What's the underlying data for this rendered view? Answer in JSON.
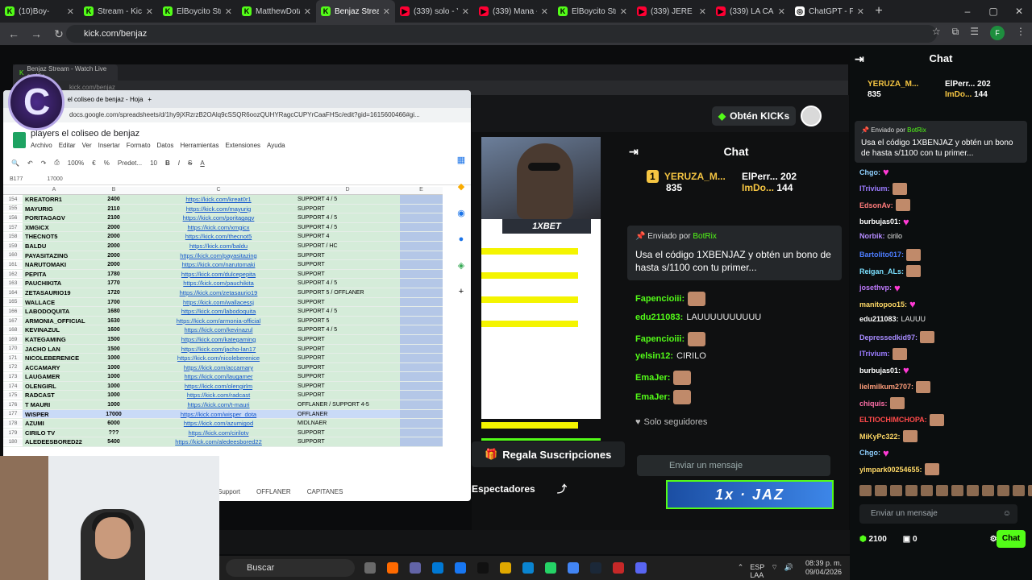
{
  "browser": {
    "tabs": [
      {
        "label": "(10)Boy-",
        "color": "#53fc18"
      },
      {
        "label": "Stream - Kick",
        "color": "#53fc18"
      },
      {
        "label": "ElBoycito Strea",
        "color": "#53fc18"
      },
      {
        "label": "MatthewDota",
        "color": "#53fc18"
      },
      {
        "label": "Benjaz Strea",
        "color": "#53fc18",
        "active": true
      },
      {
        "label": "(339) solo - Yo",
        "color": "#ff0033"
      },
      {
        "label": "(339) Mana - L",
        "color": "#ff0033"
      },
      {
        "label": "ElBoycito Strea",
        "color": "#53fc18"
      },
      {
        "label": "(339) JERE KLEI",
        "color": "#ff0033"
      },
      {
        "label": "(339) LA CANC",
        "color": "#ff0033"
      },
      {
        "label": "ChatGPT - Fran",
        "color": "#ffffff"
      }
    ],
    "url": "kick.com/benjaz",
    "profile_initial": "F"
  },
  "inner_browser": {
    "tab": "Benjaz Stream - Watch Live on Kic",
    "url": "kick.com/benjaz"
  },
  "sheet": {
    "tab": "el coliseo de benjaz - Hoja",
    "url": "docs.google.com/spreadsheets/d/1hy9jXRzrzB2OAlq9cSSQR6oozQUHYRagcCUPYrCaaFHSc/edit?gid=1615600466#gi...",
    "title": "players el coliseo de benjaz",
    "menu": [
      "Archivo",
      "Editar",
      "Ver",
      "Insertar",
      "Formato",
      "Datos",
      "Herramientas",
      "Extensiones",
      "Ayuda"
    ],
    "zoom": "100%",
    "font": "Predet...",
    "font_size": "10",
    "cell_ref": "B177",
    "formula": "17000",
    "columns": [
      "A",
      "B",
      "C",
      "D",
      "E"
    ],
    "rows": [
      {
        "n": "154",
        "name": "KREATORR1",
        "val": "2400",
        "link": "https://kick.com/kreat0r1",
        "role": "SUPPORT 4 / 5"
      },
      {
        "n": "155",
        "name": "MAYURIG",
        "val": "2110",
        "link": "https://kick.com/mayurig",
        "role": "SUPPORT"
      },
      {
        "n": "156",
        "name": "PORITAGAGV",
        "val": "2100",
        "link": "https://kick.com/poritagagv",
        "role": "SUPPORT 4 / 5"
      },
      {
        "n": "157",
        "name": "XMGICX",
        "val": "2000",
        "link": "https://kick.com/xmgicx",
        "role": "SUPPORT 4 / 5"
      },
      {
        "n": "158",
        "name": "THECNOT5",
        "val": "2000",
        "link": "https://kick.com/thecnot5",
        "role": "SUPPORT 4"
      },
      {
        "n": "159",
        "name": "BALDU",
        "val": "2000",
        "link": "https://kick.com/baldu",
        "role": "SUPPORT / HC"
      },
      {
        "n": "160",
        "name": "PAYASITAZING",
        "val": "2000",
        "link": "https://kick.com/payasitazing",
        "role": "SUPPORT"
      },
      {
        "n": "161",
        "name": "NARUTOMAKI",
        "val": "2000",
        "link": "https://kick.com/narutomaki",
        "role": "SUPPORT"
      },
      {
        "n": "162",
        "name": "PEPITA",
        "val": "1780",
        "link": "https://kick.com/dulcepepita",
        "role": "SUPPORT"
      },
      {
        "n": "163",
        "name": "PAUCHIKITA",
        "val": "1770",
        "link": "https://kick.com/pauchikita",
        "role": "SUPPORT 4 / 5"
      },
      {
        "n": "164",
        "name": "ZETASAURIO19",
        "val": "1720",
        "link": "https://kick.com/zetasaurio19",
        "role": "SUPPORT 5 / OFFLANER"
      },
      {
        "n": "165",
        "name": "WALLACE",
        "val": "1700",
        "link": "https://kick.com/wallacessj",
        "role": "SUPPORT"
      },
      {
        "n": "166",
        "name": "LABODOQUITA",
        "val": "1680",
        "link": "https://kick.com/labodoquita",
        "role": "SUPPORT 4 / 5"
      },
      {
        "n": "167",
        "name": "ARMONIA_OFFICIAL",
        "val": "1630",
        "link": "https://kick.com/armonia-official",
        "role": "SUPPORT 5"
      },
      {
        "n": "168",
        "name": "KEVINAZUL",
        "val": "1600",
        "link": "https://kick.com/kevinazul",
        "role": "SUPPORT 4 / 5"
      },
      {
        "n": "169",
        "name": "KATEGAMING",
        "val": "1500",
        "link": "https://kick.com/kategaming",
        "role": "SUPPORT"
      },
      {
        "n": "170",
        "name": "JACHO LAN",
        "val": "1500",
        "link": "https://kick.com/jacho-lan17",
        "role": "SUPPORT"
      },
      {
        "n": "171",
        "name": "NICOLEBERENICE",
        "val": "1000",
        "link": "https://kick.com/nicoleberenice",
        "role": "SUPPORT"
      },
      {
        "n": "172",
        "name": "ACCAMARY",
        "val": "1000",
        "link": "https://kick.com/accamary",
        "role": "SUPPORT"
      },
      {
        "n": "173",
        "name": "LAUGAMER",
        "val": "1000",
        "link": "https://kick.com/laugamer",
        "role": "SUPPORT"
      },
      {
        "n": "174",
        "name": "OLENGIRL",
        "val": "1000",
        "link": "https://kick.com/olengirlm",
        "role": "SUPPORT"
      },
      {
        "n": "175",
        "name": "RADCAST",
        "val": "1000",
        "link": "https://kick.com/radcast",
        "role": "SUPPORT"
      },
      {
        "n": "176",
        "name": "T MAURI",
        "val": "1000",
        "link": "https://kick.com/t-mauri",
        "role": "OFFLANER / SUPPORT 4-5"
      },
      {
        "n": "177",
        "name": "WISPER",
        "val": "17000",
        "link": "https://kick.com/wisper_dota",
        "role": "OFFLANER",
        "selected": true
      },
      {
        "n": "178",
        "name": "AZUMI",
        "val": "6000",
        "link": "https://kick.com/azumigod",
        "role": "MIDLNAER"
      },
      {
        "n": "179",
        "name": "CIRILO TV",
        "val": "???",
        "link": "https://kick.com/cirilotv",
        "role": "SUPPORT"
      },
      {
        "n": "180",
        "name": "ALEDEESBORED22",
        "val": "5400",
        "link": "https://kick.com/aledeesbored22",
        "role": "SUPPORT"
      }
    ],
    "sheet_tabs": [
      "Support",
      "OFFLANER",
      "CAPITANES"
    ]
  },
  "stream": {
    "kicks_button": "Obtén KICKs",
    "overlay_sponsor": "1XBET",
    "gift_button": "Regala Suscripciones",
    "viewers_label": "Espectadores",
    "banner": "1x · JAZ"
  },
  "mid_chat": {
    "title": "Chat",
    "leaderboard": [
      {
        "rank": "1",
        "name": "YERUZA_M...",
        "value": "835"
      },
      {
        "name": "ElPerr...",
        "value": "202"
      },
      {
        "name": "ImDo...",
        "value": "144"
      }
    ],
    "pinned_by": "Enviado por",
    "pinned_user": "BotRix",
    "pinned_text": "Usa el código 1XBENJAZ y obtén un bono de hasta s/1100 con tu primer...",
    "messages": [
      {
        "user": "Fapencioiii:",
        "text": ""
      },
      {
        "user": "edu211083:",
        "text": "LAUUUUUUUUUU"
      },
      {
        "user": "Fapencioiii:",
        "text": ""
      },
      {
        "user": "yelsin12:",
        "text": "CIRILO"
      },
      {
        "user": "EmaJer:",
        "text": ""
      },
      {
        "user": "EmaJer:",
        "text": ""
      }
    ],
    "followers_only": "Solo seguidores",
    "input_placeholder": "Enviar un mensaje"
  },
  "right_chat": {
    "title": "Chat",
    "leaderboard": [
      {
        "name": "YERUZA_M...",
        "value": "835"
      },
      {
        "name": "ElPerr...",
        "value": "202"
      },
      {
        "name": "ImDo...",
        "value": "144"
      }
    ],
    "pinned_by": "Enviado por",
    "pinned_user": "BotRix",
    "pinned_text": "Usa el código 1XBENJAZ y obtén un bono de hasta s/1100 con tu primer...",
    "messages": [
      {
        "user": "Chgo:",
        "text": "",
        "color": "#8fd0ff"
      },
      {
        "user": "ITrivium:",
        "text": "",
        "color": "#9b7bff"
      },
      {
        "user": "EdsonAv:",
        "text": "",
        "color": "#ff7b7b"
      },
      {
        "user": "burbujas01:",
        "text": "",
        "color": "#ffffff"
      },
      {
        "user": "Norbik:",
        "text": "cirilo",
        "color": "#b58bff"
      },
      {
        "user": "Bartolito017:",
        "text": "",
        "color": "#4d7dff"
      },
      {
        "user": "Reigan_ALs:",
        "text": "",
        "color": "#7be0ff"
      },
      {
        "user": "josethvp:",
        "text": "",
        "color": "#c07bff"
      },
      {
        "user": "manitopoo15:",
        "text": "",
        "color": "#ffd966"
      },
      {
        "user": "edu211083:",
        "text": "LAUUU",
        "color": "#ffffff"
      },
      {
        "user": "Depressedkid97:",
        "text": "",
        "color": "#a78bff"
      },
      {
        "user": "ITrivium:",
        "text": "",
        "color": "#9b7bff"
      },
      {
        "user": "burbujas01:",
        "text": "",
        "color": "#ffffff"
      },
      {
        "user": "lielmilkum2707:",
        "text": "",
        "color": "#ff9e7b"
      },
      {
        "user": "chiquis:",
        "text": "",
        "color": "#ff6fa8"
      },
      {
        "user": "ELTIOCHIMCHOPA:",
        "text": "",
        "color": "#ff4a4a"
      },
      {
        "user": "MiKyPc322:",
        "text": "",
        "color": "#ffd966"
      },
      {
        "user": "Chgo:",
        "text": "",
        "color": "#8fd0ff"
      },
      {
        "user": "yimpark00254655:",
        "text": "",
        "color": "#ffd966"
      }
    ],
    "input_placeholder": "Enviar un mensaje",
    "points": "2100",
    "gifts": "0",
    "chat_button": "Chat"
  },
  "taskbar": {
    "search": "Buscar",
    "lang_1": "ESP",
    "lang_2": "LAA",
    "time": "08:39 p. m.",
    "date": "09/04/2026"
  },
  "colors": {
    "kick_green": "#53fc18",
    "chat_bg": "#0b0e0f",
    "sheet_green": "#d5ecd9",
    "selection_blue": "#b4c7e7"
  }
}
